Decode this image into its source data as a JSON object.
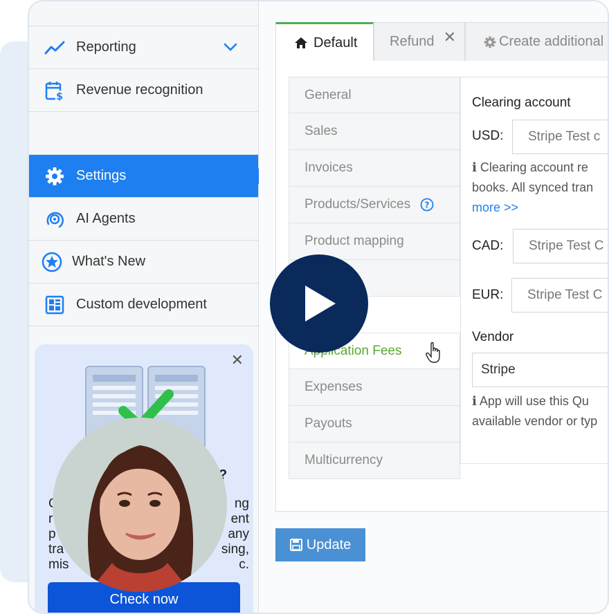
{
  "sidebar": {
    "items": [
      {
        "label": "Reporting",
        "icon": "trend-line-icon"
      },
      {
        "label": "Revenue recognition",
        "icon": "calendar-dollar-icon"
      },
      {
        "label": "Settings",
        "icon": "gear-icon"
      },
      {
        "label": "AI Agents",
        "icon": "ai-target-icon"
      },
      {
        "label": "What's New",
        "icon": "star-circle-icon"
      },
      {
        "label": "Custom development",
        "icon": "grid-layout-icon"
      }
    ]
  },
  "promo": {
    "question_mark": "?",
    "lines": [
      "C",
      "ng",
      "r",
      "ent",
      "p",
      "any",
      "tra",
      "sing,",
      "mis",
      "c."
    ],
    "cta": "Check now"
  },
  "tabs": [
    {
      "label": "Default",
      "icon": "home-icon"
    },
    {
      "label": "Refund",
      "close": "✕"
    },
    {
      "label": "Create additional",
      "icon": "gear-icon"
    }
  ],
  "subnav": [
    "General",
    "Sales",
    "Invoices",
    "Products/Services",
    "Product mapping",
    "Application Fees",
    "Expenses",
    "Payouts",
    "Multicurrency"
  ],
  "panel": {
    "clearing_title": "Clearing account",
    "usd_label": "USD:",
    "usd_value": "Stripe Test c",
    "info1_line1": "Clearing account re",
    "info1_line2": "books. All synced tran",
    "more": "more >>",
    "cad_label": "CAD:",
    "cad_value": "Stripe Test C",
    "eur_label": "EUR:",
    "eur_value": "Stripe Test C",
    "vendor_title": "Vendor",
    "vendor_value": "Stripe",
    "info2_line1": "App will use this Qu",
    "info2_line2": "available vendor or typ"
  },
  "update_label": "Update",
  "colors": {
    "accent": "#1e7ff0",
    "active_tab": "#4caf50",
    "app_fees": "#5aa832",
    "play": "#0a2a5c"
  }
}
